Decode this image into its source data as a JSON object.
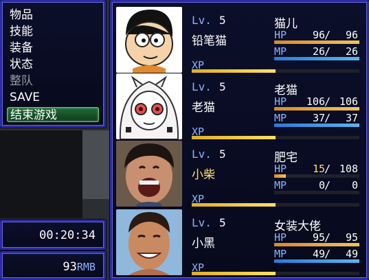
{
  "menu": {
    "items": [
      {
        "label": "物品",
        "state": "normal"
      },
      {
        "label": "技能",
        "state": "normal"
      },
      {
        "label": "装备",
        "state": "normal"
      },
      {
        "label": "状态",
        "state": "normal"
      },
      {
        "label": "整队",
        "state": "disabled"
      },
      {
        "label": "SAVE",
        "state": "normal"
      },
      {
        "label": "结束游戏",
        "state": "selected"
      }
    ]
  },
  "playtime": "00:20:34",
  "gold": {
    "amount": "93",
    "unit": "RMB"
  },
  "labels": {
    "lv": "Lv.",
    "hp": "HP",
    "mp": "MP",
    "xp": "XP",
    "sep": "/"
  },
  "colors": {
    "hp_gradient": [
      "#d98a2a",
      "#f0c45a"
    ],
    "mp_gradient": [
      "#2a7ad9",
      "#5ab6f0"
    ],
    "xp_gradient": [
      "#e0b020",
      "#ffe060"
    ],
    "low_value": "#ffe070",
    "system_label": "#8ab4ff"
  },
  "actors": [
    {
      "face_icon": "nobita-face-icon",
      "level": "5",
      "name": "铅笔猫",
      "class": "猫儿",
      "low": false,
      "hp": {
        "cur": "96",
        "max": "96",
        "ratio": 1.0
      },
      "mp": {
        "cur": "26",
        "max": "26",
        "ratio": 1.0
      },
      "xp_ratio": 0.5
    },
    {
      "face_icon": "white-haired-girl-face-icon",
      "level": "5",
      "name": "老猫",
      "class": "老猫",
      "low": false,
      "hp": {
        "cur": "106",
        "max": "106",
        "ratio": 1.0
      },
      "mp": {
        "cur": "37",
        "max": "37",
        "ratio": 1.0
      },
      "xp_ratio": 0.5
    },
    {
      "face_icon": "laughing-man-face-icon",
      "level": "5",
      "name": "小柴",
      "class": "肥宅",
      "low": true,
      "hp": {
        "cur": "15",
        "max": "108",
        "ratio": 0.14
      },
      "mp": {
        "cur": "0",
        "max": "0",
        "ratio": 0
      },
      "xp_ratio": 0.5
    },
    {
      "face_icon": "smiling-man-face-icon",
      "level": "5",
      "name": "小黑",
      "class": "女装大佬",
      "low": false,
      "hp": {
        "cur": "95",
        "max": "95",
        "ratio": 1.0
      },
      "mp": {
        "cur": "49",
        "max": "49",
        "ratio": 1.0
      },
      "xp_ratio": 0.5
    }
  ]
}
